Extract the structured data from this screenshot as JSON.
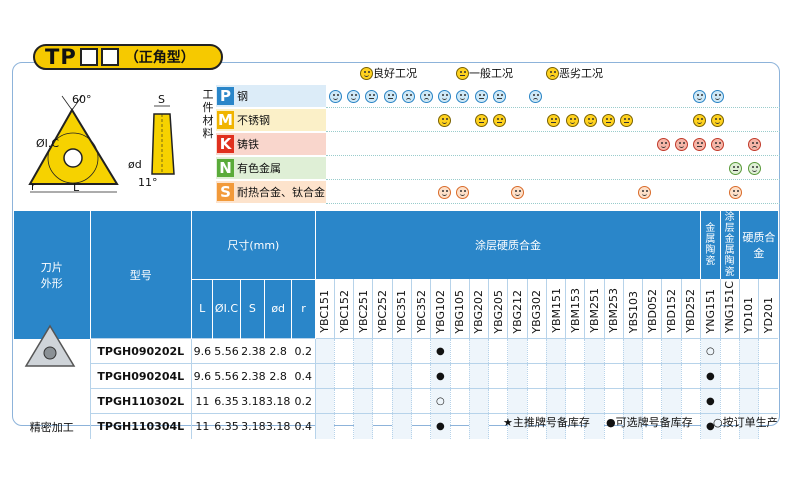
{
  "title": {
    "main": "TP",
    "sub": "（正角型）"
  },
  "legend": [
    {
      "face": "good",
      "text": "良好工况"
    },
    {
      "face": "mid",
      "text": "一般工况"
    },
    {
      "face": "bad",
      "text": "恶劣工况"
    }
  ],
  "diagram": {
    "angle": "60°",
    "ic": "ØI.C",
    "r": "r",
    "l": "L",
    "s": "S",
    "d": "ød",
    "clearance": "11°"
  },
  "work_material_label": "工件材料",
  "materials": [
    {
      "letter": "P",
      "color": "#2a86c9",
      "bg": "#dcecf8",
      "text": "钢"
    },
    {
      "letter": "M",
      "color": "#f0b400",
      "bg": "#fbf0c8",
      "text": "不锈钢"
    },
    {
      "letter": "K",
      "color": "#e0301e",
      "bg": "#f9d6cc",
      "text": "铸铁"
    },
    {
      "letter": "N",
      "color": "#5aab3a",
      "bg": "#dfefd6",
      "text": "有色金属"
    },
    {
      "letter": "S",
      "color": "#f29a3a",
      "bg": "#fde3cc",
      "text": "耐热合金、钛合金"
    }
  ],
  "table": {
    "col_shape": "刀片\n外形",
    "col_model": "型号",
    "col_dims": "尺寸(mm)",
    "dim_heads": [
      "L",
      "ØI.C",
      "S",
      "ød",
      "r"
    ],
    "group_coated": "涂层硬质合金",
    "group_cermet": "金属陶瓷",
    "group_coated_cermet": "涂层金属陶瓷",
    "group_carbide": "硬质合金",
    "grades": [
      "YBC151",
      "YBC152",
      "YBC251",
      "YBC252",
      "YBC351",
      "YBC352",
      "YBG102",
      "YBG105",
      "YBG202",
      "YBG205",
      "YBG212",
      "YBG302",
      "YBM151",
      "YBM153",
      "YBM251",
      "YBM253",
      "YBS103",
      "YBD052",
      "YBD152",
      "YBD252",
      "YNG151",
      "YNG151C",
      "YD101",
      "YD201"
    ],
    "rows": [
      {
        "model": "TPGH090202L",
        "L": "9.6",
        "IC": "5.56",
        "S": "2.38",
        "d": "2.8",
        "r": "0.2",
        "marks": {
          "YBG102": "●",
          "YNG151": "○"
        }
      },
      {
        "model": "TPGH090204L",
        "L": "9.6",
        "IC": "5.56",
        "S": "2.38",
        "d": "2.8",
        "r": "0.4",
        "marks": {
          "YBG102": "●",
          "YNG151": "●"
        }
      },
      {
        "model": "TPGH110302L",
        "L": "11",
        "IC": "6.35",
        "S": "3.18",
        "d": "3.18",
        "r": "0.2",
        "marks": {
          "YBG102": "○",
          "YNG151": "●"
        }
      },
      {
        "model": "TPGH110304L",
        "L": "11",
        "IC": "6.35",
        "S": "3.18",
        "d": "3.18",
        "r": "0.4",
        "marks": {
          "YBG102": "●",
          "YNG151": "●"
        }
      }
    ],
    "shape_caption": "精密加工"
  },
  "footnotes": [
    "★主推牌号备库存",
    "●可选牌号备库存",
    "○按订单生产"
  ]
}
